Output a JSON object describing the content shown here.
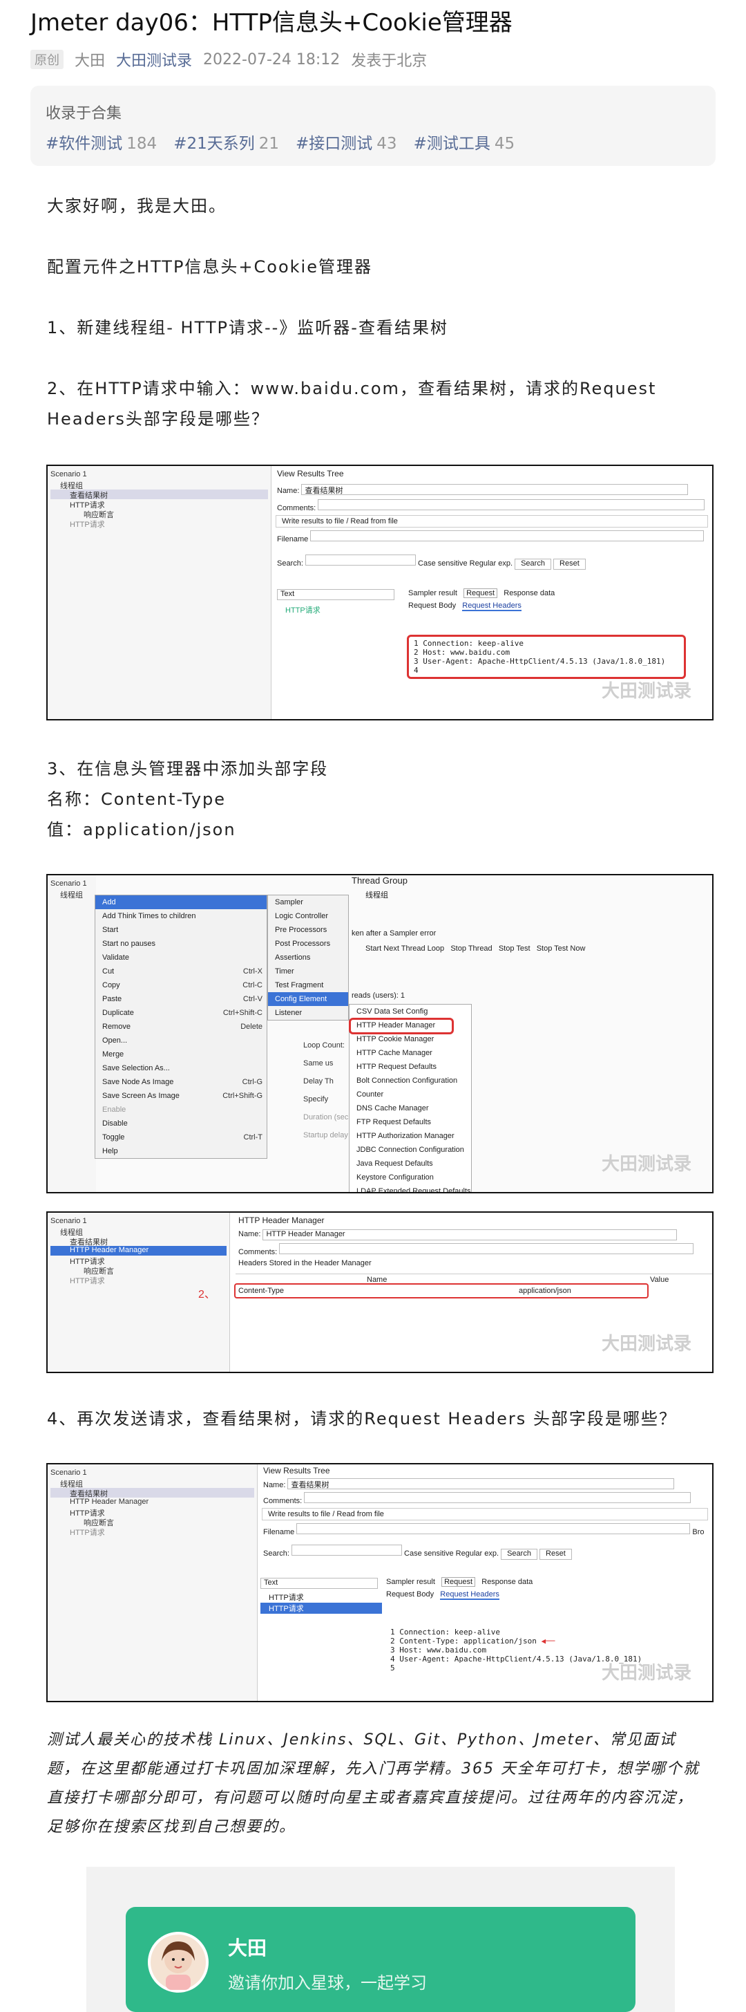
{
  "article": {
    "title": "Jmeter day06：HTTP信息头+Cookie管理器",
    "badge": "原创",
    "author": "大田",
    "account": "大田测试录",
    "datetime": "2022-07-24 18:12",
    "location": "发表于北京"
  },
  "collection": {
    "header": "收录于合集",
    "tags": [
      {
        "label": "#软件测试",
        "count": "184"
      },
      {
        "label": "#21天系列",
        "count": "21"
      },
      {
        "label": "#接口测试",
        "count": "43"
      },
      {
        "label": "#测试工具",
        "count": "45"
      }
    ]
  },
  "body": {
    "p1": "大家好啊，我是大田。",
    "p2": "配置元件之HTTP信息头+Cookie管理器",
    "p3": "1、新建线程组- HTTP请求--》监听器-查看结果树",
    "p4": "2、在HTTP请求中输入：www.baidu.com，查看结果树，请求的Request Headers头部字段是哪些？",
    "p5a": "3、在信息头管理器中添加头部字段",
    "p5b": "名称：Content-Type",
    "p5c": "值：application/json",
    "p6": "4、再次发送请求，查看结果树，请求的Request Headers 头部字段是哪些？",
    "p7": "测试人最关心的技术栈 Linux、Jenkins、SQL、Git、Python、Jmeter、常见面试题，在这里都能通过打卡巩固加深理解，先入门再学精。365 天全年可打卡，想学哪个就直接打卡哪部分即可，有问题可以随时向星主或者嘉宾直接提问。过往两年的内容沉淀，足够你在搜索区找到自己想要的。"
  },
  "watermark": "大田测试录",
  "shot1": {
    "tree": [
      "Scenario 1",
      "线程组",
      "查看结果树",
      "HTTP请求",
      "响应断言",
      "HTTP请求"
    ],
    "panel_title": "View Results Tree",
    "name_label": "Name:",
    "name_value": "查看结果树",
    "comments_label": "Comments:",
    "write_label": "Write results to file / Read from file",
    "filename_label": "Filename",
    "search_label": "Search:",
    "case_label": "Case sensitive",
    "regex_label": "Regular exp.",
    "search_btn": "Search",
    "reset_btn": "Reset",
    "render": "Text",
    "result_item": "HTTP请求",
    "tabs": [
      "Sampler result",
      "Request",
      "Response data"
    ],
    "subtabs": [
      "Request Body",
      "Request Headers"
    ],
    "lines": [
      "1  Connection: keep-alive",
      "2  Host: www.baidu.com",
      "3  User-Agent: Apache-HttpClient/4.5.13 (Java/1.8.0_181)",
      "4"
    ]
  },
  "shot2": {
    "tree": [
      "Scenario 1",
      "线程组"
    ],
    "ctx": [
      "Add",
      "Add Think Times to children",
      "Start",
      "Start no pauses",
      "Validate",
      "Cut",
      "Copy",
      "Paste",
      "Duplicate",
      "Remove",
      "Open...",
      "Merge",
      "Save Selection As...",
      "Save Node As Image",
      "Save Screen As Image",
      "Enable",
      "Disable",
      "Toggle",
      "Help"
    ],
    "ctx_keys": {
      "Cut": "Ctrl-X",
      "Copy": "Ctrl-C",
      "Paste": "Ctrl-V",
      "Duplicate": "Ctrl+Shift-C",
      "Remove": "Delete",
      "Save Node As Image": "Ctrl-G",
      "Save Screen As Image": "Ctrl+Shift-G",
      "Toggle": "Ctrl-T"
    },
    "sub": [
      "Sampler",
      "Logic Controller",
      "Pre Processors",
      "Post Processors",
      "Assertions",
      "Timer",
      "Test Fragment",
      "Config Element",
      "Listener"
    ],
    "cfg": [
      "CSV Data Set Config",
      "HTTP Header Manager",
      "HTTP Cookie Manager",
      "HTTP Cache Manager",
      "HTTP Request Defaults",
      "Bolt Connection Configuration",
      "Counter",
      "DNS Cache Manager",
      "FTP Request Defaults",
      "HTTP Authorization Manager",
      "JDBC Connection Configuration",
      "Java Request Defaults",
      "Keystore Configuration",
      "LDAP Extended Request Defaults"
    ],
    "panel": {
      "group": "Thread Group",
      "name": "线程组",
      "after": "ken after a Sampler error",
      "opts": [
        "Start Next Thread Loop",
        "Stop Thread",
        "Stop Test",
        "Stop Test Now"
      ],
      "threads": "reads (users):",
      "threads_val": "1",
      "loop": "Loop Count:",
      "same": "Same us",
      "delay": "Delay Th",
      "specify": "Specify",
      "duration": "Duration (sec",
      "startup": "Startup delay"
    }
  },
  "shot3": {
    "tree": [
      "Scenario 1",
      "线程组",
      "查看结果树",
      "HTTP Header Manager",
      "HTTP请求",
      "响应断言",
      "HTTP请求"
    ],
    "title": "HTTP Header Manager",
    "name_label": "Name:",
    "name_value": "HTTP Header Manager",
    "comments_label": "Comments:",
    "stored": "Headers Stored in the Header Manager",
    "col_name": "Name",
    "col_value": "Value",
    "row_name": "Content-Type",
    "row_value": "application/json",
    "marker": "2、"
  },
  "shot4": {
    "tree": [
      "Scenario 1",
      "线程组",
      "查看结果树",
      "HTTP Header Manager",
      "HTTP请求",
      "响应断言",
      "HTTP请求"
    ],
    "result_items": [
      "HTTP请求",
      "HTTP请求"
    ],
    "lines": [
      "1  Connection: keep-alive",
      "2  Content-Type: application/json",
      "3  Host: www.baidu.com",
      "4  User-Agent: Apache-HttpClient/4.5.13 (Java/1.8.0_181)",
      "5"
    ],
    "browse": "Bro"
  },
  "card": {
    "name": "大田",
    "subtitle": "邀请你加入星球，一起学习"
  }
}
